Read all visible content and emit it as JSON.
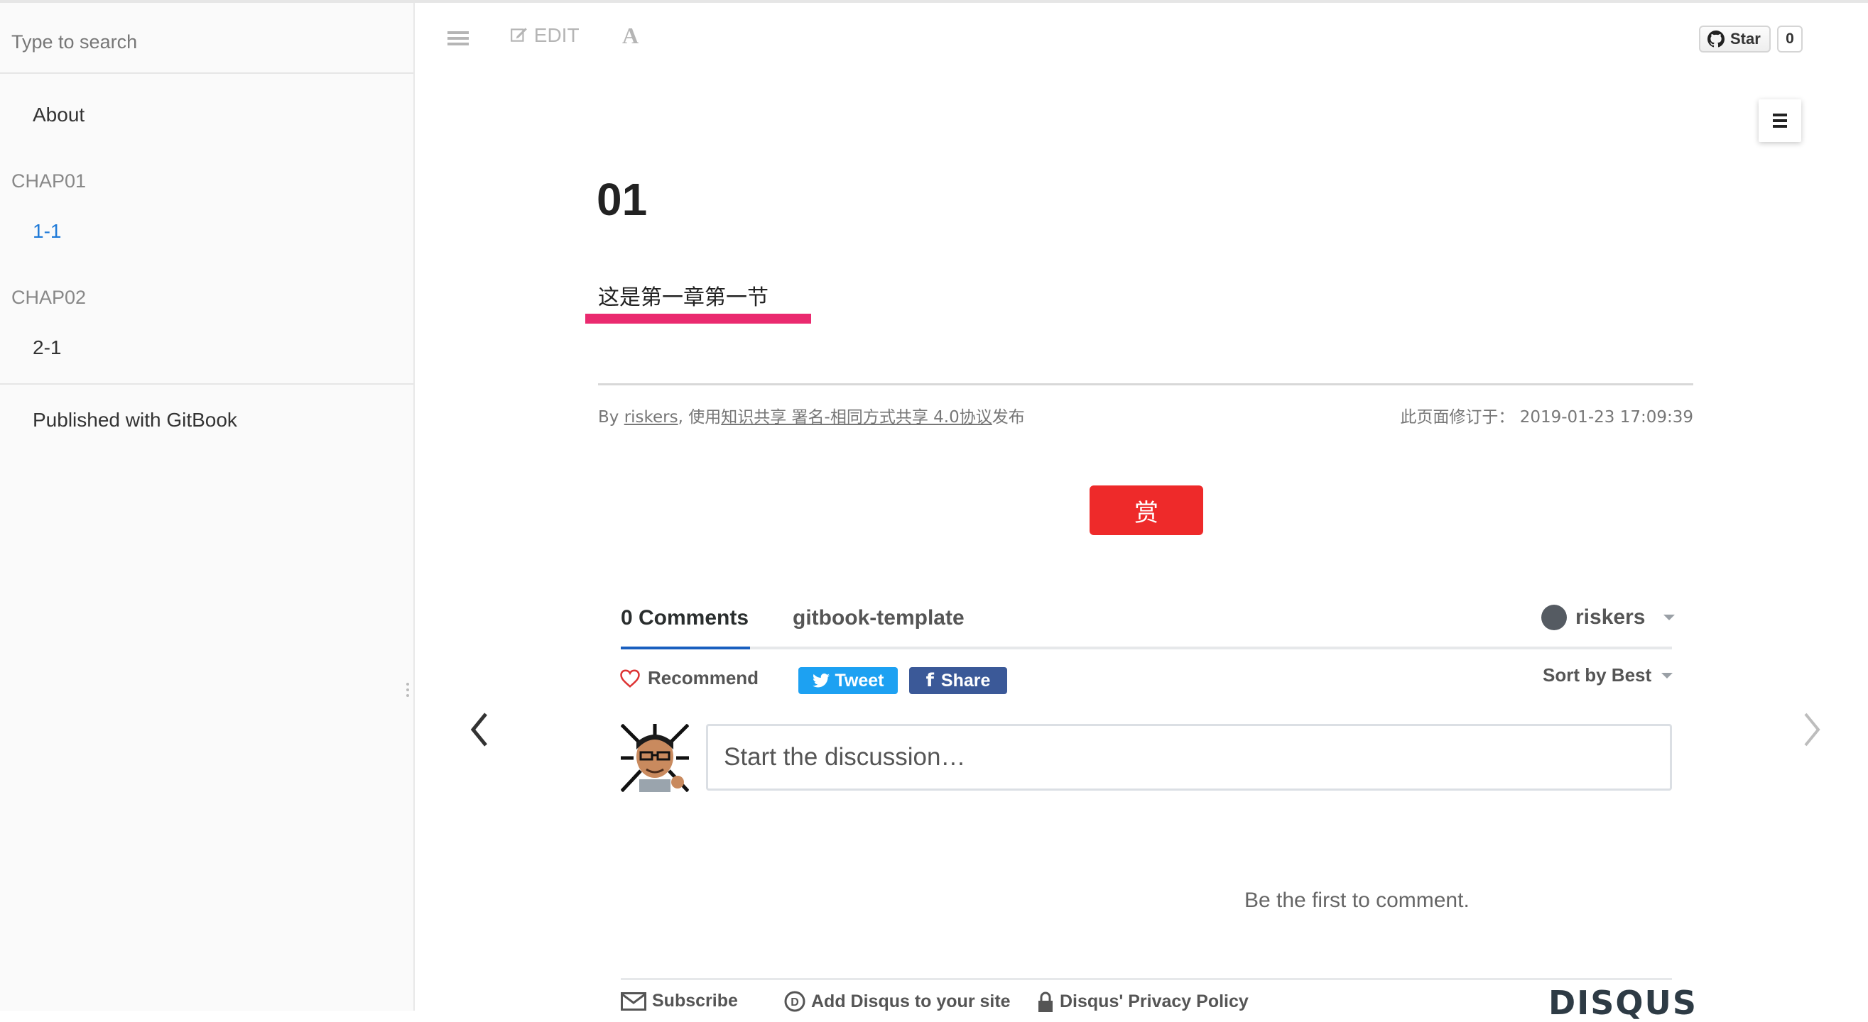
{
  "search": {
    "placeholder": "Type to search"
  },
  "sidebar": {
    "about": "About",
    "chapters": [
      {
        "header": "CHAP01",
        "item": "1-1"
      },
      {
        "header": "CHAP02",
        "item": "2-1"
      }
    ],
    "published": "Published with GitBook"
  },
  "toolbar": {
    "edit_label": "EDIT",
    "font_label": "A"
  },
  "github": {
    "star_label": "Star",
    "star_count": "0"
  },
  "page": {
    "title": "01",
    "body": "这是第一章第一节",
    "footer": {
      "by": "By ",
      "author": "riskers",
      "sep": ", 使用",
      "license": "知识共享 署名-相同方式共享 4.0协议",
      "suffix": "发布",
      "modified_label": "此页面修订于：",
      "modified_time": "2019-01-23 17:09:39"
    },
    "reward_label": "赏"
  },
  "disqus": {
    "comments_tab": "0 Comments",
    "site_tab": "gitbook-template",
    "user": "riskers",
    "recommend": "Recommend",
    "tweet": "Tweet",
    "share": "Share",
    "sort": "Sort by Best",
    "input_placeholder": "Start the discussion…",
    "empty": "Be the first to comment.",
    "subscribe": "Subscribe",
    "add_disqus": "Add Disqus to your site",
    "privacy": "Disqus' Privacy Policy",
    "logo": "DISQUS"
  },
  "colors": {
    "accent_link": "#1f7ad8",
    "underline_pink": "#ea2a6f",
    "reward_red": "#ee2a2a",
    "twitter": "#1da1f2",
    "facebook": "#3b5998"
  }
}
